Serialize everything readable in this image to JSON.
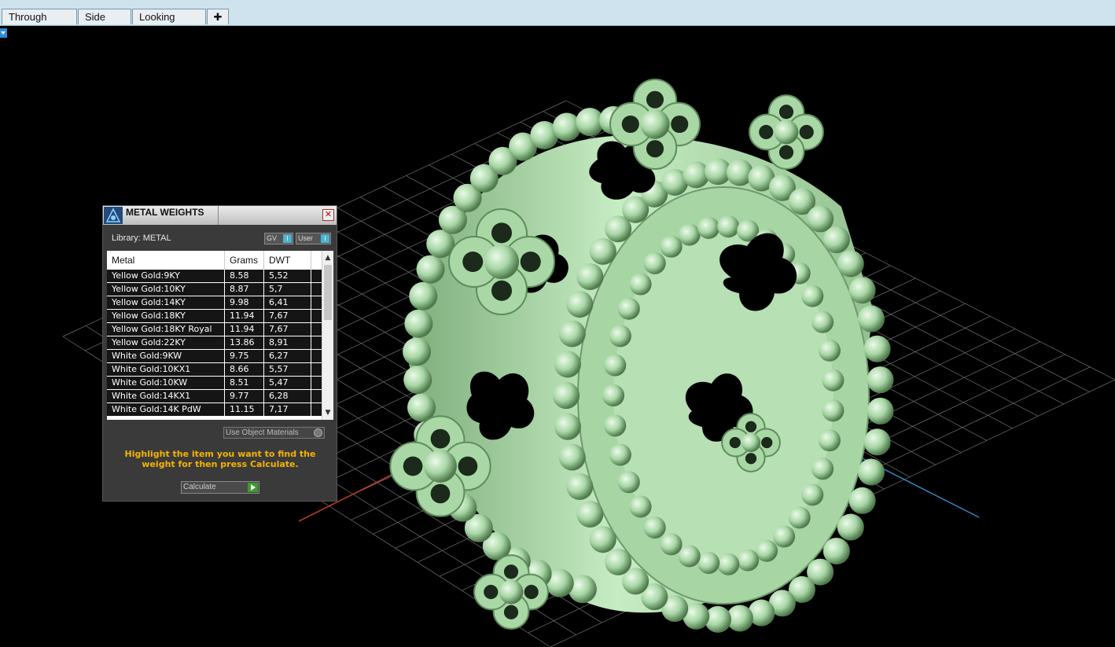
{
  "tabs": [
    {
      "label": "Through Finger"
    },
    {
      "label": "Side View"
    },
    {
      "label": "Looking Down"
    }
  ],
  "add_tab_icon": "plus-icon",
  "colors": {
    "tab_bar": "#cfe3ef",
    "viewport_bg": "#000000",
    "grid": "#9a9a9a",
    "axis_red": "#c0392b",
    "axis_blue": "#2e86c1",
    "model": "#bfe6bc",
    "hint_text": "#f4b400"
  },
  "panel": {
    "title": "METAL WEIGHTS",
    "library_label": "Library: METAL",
    "gv_label": "GV",
    "user_label": "User",
    "table": {
      "columns": [
        "Metal",
        "Grams",
        "DWT"
      ],
      "rows": [
        [
          "Yellow Gold:9KY",
          "8.58",
          "5,52"
        ],
        [
          "Yellow Gold:10KY",
          "8.87",
          "5,7"
        ],
        [
          "Yellow Gold:14KY",
          "9.98",
          "6,41"
        ],
        [
          "Yellow Gold:18KY",
          "11.94",
          "7,67"
        ],
        [
          "Yellow Gold:18KY Royal",
          "11.94",
          "7,67"
        ],
        [
          "Yellow Gold:22KY",
          "13.86",
          "8,91"
        ],
        [
          "White Gold:9KW",
          "9.75",
          "6,27"
        ],
        [
          "White Gold:10KX1",
          "8.66",
          "5,57"
        ],
        [
          "White Gold:10KW",
          "8.51",
          "5,47"
        ],
        [
          "White Gold:14KX1",
          "9.77",
          "6,28"
        ],
        [
          "White Gold:14K PdW",
          "11.15",
          "7,17"
        ]
      ]
    },
    "use_object_materials": "Use Object Materials",
    "hint": "Highlight the item you want to find the weight for then press Calculate.",
    "calculate_label": "Calculate"
  }
}
